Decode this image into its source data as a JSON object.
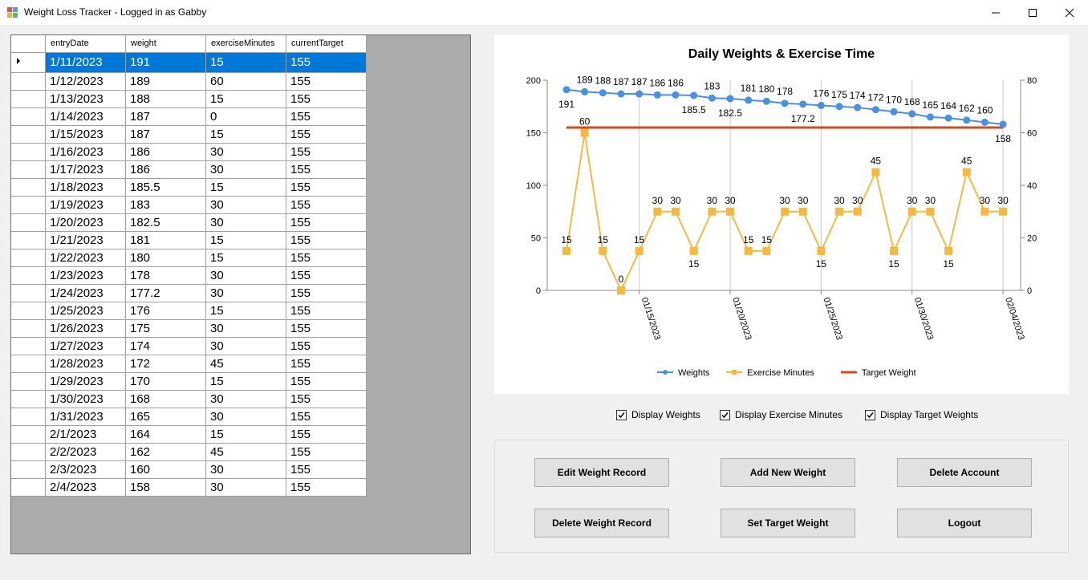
{
  "window": {
    "title": "Weight Loss Tracker - Logged in as Gabby"
  },
  "grid": {
    "columns": [
      "entryDate",
      "weight",
      "exerciseMinutes",
      "currentTarget"
    ],
    "selected_row": 0,
    "rows": [
      [
        "1/11/2023",
        "191",
        "15",
        "155"
      ],
      [
        "1/12/2023",
        "189",
        "60",
        "155"
      ],
      [
        "1/13/2023",
        "188",
        "15",
        "155"
      ],
      [
        "1/14/2023",
        "187",
        "0",
        "155"
      ],
      [
        "1/15/2023",
        "187",
        "15",
        "155"
      ],
      [
        "1/16/2023",
        "186",
        "30",
        "155"
      ],
      [
        "1/17/2023",
        "186",
        "30",
        "155"
      ],
      [
        "1/18/2023",
        "185.5",
        "15",
        "155"
      ],
      [
        "1/19/2023",
        "183",
        "30",
        "155"
      ],
      [
        "1/20/2023",
        "182.5",
        "30",
        "155"
      ],
      [
        "1/21/2023",
        "181",
        "15",
        "155"
      ],
      [
        "1/22/2023",
        "180",
        "15",
        "155"
      ],
      [
        "1/23/2023",
        "178",
        "30",
        "155"
      ],
      [
        "1/24/2023",
        "177.2",
        "30",
        "155"
      ],
      [
        "1/25/2023",
        "176",
        "15",
        "155"
      ],
      [
        "1/26/2023",
        "175",
        "30",
        "155"
      ],
      [
        "1/27/2023",
        "174",
        "30",
        "155"
      ],
      [
        "1/28/2023",
        "172",
        "45",
        "155"
      ],
      [
        "1/29/2023",
        "170",
        "15",
        "155"
      ],
      [
        "1/30/2023",
        "168",
        "30",
        "155"
      ],
      [
        "1/31/2023",
        "165",
        "30",
        "155"
      ],
      [
        "2/1/2023",
        "164",
        "15",
        "155"
      ],
      [
        "2/2/2023",
        "162",
        "45",
        "155"
      ],
      [
        "2/3/2023",
        "160",
        "30",
        "155"
      ],
      [
        "2/4/2023",
        "158",
        "30",
        "155"
      ]
    ]
  },
  "chart_data": {
    "type": "line",
    "title": "Daily Weights & Exercise Time",
    "x": [
      "1/11/2023",
      "1/12/2023",
      "1/13/2023",
      "1/14/2023",
      "1/15/2023",
      "1/16/2023",
      "1/17/2023",
      "1/18/2023",
      "1/19/2023",
      "1/20/2023",
      "1/21/2023",
      "1/22/2023",
      "1/23/2023",
      "1/24/2023",
      "1/25/2023",
      "1/26/2023",
      "1/27/2023",
      "1/28/2023",
      "1/29/2023",
      "1/30/2023",
      "1/31/2023",
      "2/1/2023",
      "2/2/2023",
      "2/3/2023",
      "2/4/2023"
    ],
    "x_tick_labels": [
      "01/15/2023",
      "01/20/2023",
      "01/25/2023",
      "01/30/2023",
      "02/04/2023"
    ],
    "x_tick_dates": [
      "1/15/2023",
      "1/20/2023",
      "1/25/2023",
      "1/30/2023",
      "2/4/2023"
    ],
    "y_left": {
      "min": 0,
      "max": 200,
      "ticks": [
        0,
        50,
        100,
        150,
        200
      ]
    },
    "y_right": {
      "min": 0,
      "max": 80,
      "ticks": [
        0,
        20,
        40,
        60,
        80
      ]
    },
    "series": [
      {
        "name": "Weights",
        "axis": "left",
        "marker": "circle",
        "color": "#4a90e2",
        "values": [
          191,
          189,
          188,
          187,
          187,
          186,
          186,
          185.5,
          183,
          182.5,
          181,
          180,
          178,
          177.2,
          176,
          175,
          174,
          172,
          170,
          168,
          165,
          164,
          162,
          160,
          158
        ]
      },
      {
        "name": "Exercise Minutes",
        "axis": "right",
        "marker": "square",
        "color": "#f5b942",
        "values": [
          15,
          60,
          15,
          0,
          15,
          30,
          30,
          15,
          30,
          30,
          15,
          15,
          30,
          30,
          15,
          30,
          30,
          45,
          15,
          30,
          30,
          15,
          45,
          30,
          30
        ]
      },
      {
        "name": "Target Weight",
        "axis": "left",
        "marker": "none",
        "color": "#d24b1e",
        "values": [
          155,
          155,
          155,
          155,
          155,
          155,
          155,
          155,
          155,
          155,
          155,
          155,
          155,
          155,
          155,
          155,
          155,
          155,
          155,
          155,
          155,
          155,
          155,
          155,
          155
        ]
      }
    ],
    "legend_position": "bottom",
    "grid": "vertical"
  },
  "options": {
    "display_weights": {
      "label": "Display Weights",
      "checked": true
    },
    "display_exercise": {
      "label": "Display Exercise Minutes",
      "checked": true
    },
    "display_target": {
      "label": "Display Target Weights",
      "checked": true
    }
  },
  "buttons": {
    "edit_weight": "Edit Weight Record",
    "add_weight": "Add New Weight",
    "delete_account": "Delete Account",
    "delete_weight": "Delete Weight Record",
    "set_target": "Set Target Weight",
    "logout": "Logout"
  }
}
